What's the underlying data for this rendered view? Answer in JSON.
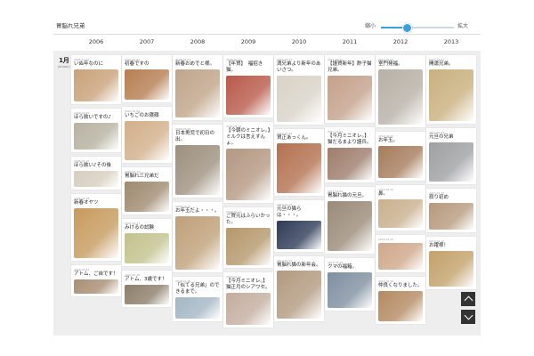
{
  "header": {
    "title": "胃脳れ兄弟",
    "zoom_min": "縮小",
    "zoom_max": "拡大",
    "zoom_level": 0.35
  },
  "years": [
    "2006",
    "2007",
    "2008",
    "2009",
    "2010",
    "2011",
    "2012",
    "2013"
  ],
  "month": {
    "label": "1月",
    "sub": "January"
  },
  "columns": [
    [
      {
        "date": "2006.01.01",
        "title": "いぬ年なのに",
        "h": 36,
        "c": "#c9a27a"
      },
      {
        "date": "2006.01.05",
        "title": "ほら飲いですの♪",
        "h": 30,
        "c": "#b7b2a0"
      },
      {
        "date": "2006.01.10",
        "title": "ほら飲い♪その後",
        "h": 18,
        "c": "#d6cfc0"
      },
      {
        "date": "2006.01.18",
        "title": "新春オヤツ",
        "h": 56,
        "c": "#c79a5e"
      },
      {
        "date": "2006.01.25",
        "title": "アトム、ご自です！",
        "h": 16,
        "c": "#a98e74"
      }
    ],
    [
      {
        "date": "2007.01.01",
        "title": "初春ですの",
        "h": 34,
        "c": "#b67e52"
      },
      {
        "date": "2007.01.04",
        "title": "いちごのお寝顔",
        "h": 44,
        "c": "#d2b08a"
      },
      {
        "date": "2007.01.10",
        "title": "胃脳れ三兄弟だ",
        "h": 34,
        "c": "#9f8a70"
      },
      {
        "date": "2007.01.17",
        "title": "みけるの試験",
        "h": 34,
        "c": "#c2c28e"
      },
      {
        "date": "2007.01.26",
        "title": "アトム、3歳です！",
        "h": 22,
        "c": "#8c7e6a"
      }
    ],
    [
      {
        "date": "2008.01.01",
        "title": "新春おめでと様。",
        "h": 54,
        "c": "#c0a58a"
      },
      {
        "date": "2008.01.06",
        "title": "日本男児で初日の出。",
        "h": 56,
        "c": "#9d907e"
      },
      {
        "date": "2008.01.14",
        "title": "お年玉だよ・・・。",
        "h": 60,
        "c": "#bfa079"
      },
      {
        "date": "2008.01.28",
        "title": "「似てる兄弟」のできるまで。",
        "h": 24,
        "c": "#a4b7c5"
      }
    ],
    [
      {
        "date": "2009.01.01",
        "title": "【年賀】　福招き猫。",
        "h": 44,
        "c": "#b85a4a"
      },
      {
        "date": "2009.01.05",
        "title": "【今朝のミニオレ。】ミルクは言えすんょ。",
        "h": 58,
        "c": "#b49882"
      },
      {
        "date": "2009.01.11",
        "title": "ご賀元はふらいかった。",
        "h": 42,
        "c": "#b5986c"
      },
      {
        "date": "2009.01.20",
        "title": "【今月ミニオレ。】猫正月のシアワセ。",
        "h": 36,
        "c": "#c3aea0"
      }
    ],
    [
      {
        "date": "2010.01.01",
        "title": "満兄弟より新年のあいさつ。",
        "h": 52,
        "c": "#d9d3c8"
      },
      {
        "date": "2010.01.04",
        "title": "賀正あっくん。",
        "h": 56,
        "c": "#b3714f"
      },
      {
        "date": "2010.01.12",
        "title": "元旦の猫らは・・・。",
        "h": 32,
        "c": "#2f3b58"
      },
      {
        "date": "2010.01.22",
        "title": "胃脳れ猫の新年会。",
        "h": 54,
        "c": "#b29a80"
      }
    ],
    [
      {
        "date": "2011.01.01",
        "title": "【謹賀新年】酢子猫兄弟。",
        "h": 50,
        "c": "#c4a18b"
      },
      {
        "date": "2011.01.03",
        "title": "【今月ミニオレ。】猫だるまより謹兵。",
        "h": 36,
        "c": "#9e7d6c"
      },
      {
        "date": "2011.01.08",
        "title": "胃脳れ猫の元旦。",
        "h": 56,
        "c": "#9a8a78"
      },
      {
        "date": "2011.01.19",
        "title": "クマの福箱。",
        "h": 40,
        "c": "#7f8fa0"
      }
    ],
    [
      {
        "date": "2012.01.01",
        "title": "室門発福。",
        "h": 62,
        "c": "#b7b0a6"
      },
      {
        "date": "2012.01.05",
        "title": "お年玉。",
        "h": 36,
        "c": "#a67c5c"
      },
      {
        "date": "2012.01.10",
        "title": "鼻。",
        "h": 32,
        "c": "#c9b08e"
      },
      {
        "date": "2012.01.16",
        "title": "",
        "h": 30,
        "c": "#d0a78a"
      },
      {
        "date": "2012.01.24",
        "title": "仲良くなりました。",
        "h": 34,
        "c": "#b48a62"
      }
    ],
    [
      {
        "date": "2013.01.01",
        "title": "開運兄弟。",
        "h": 58,
        "c": "#c9b07e"
      },
      {
        "date": "2013.01.04",
        "title": "元旦の兄弟",
        "h": 44,
        "c": "#9fa0a2"
      },
      {
        "date": "2013.01.10",
        "title": "寂り初め",
        "h": 30,
        "c": "#b79a7e"
      },
      {
        "date": "2013.01.15",
        "title": "お躍様！",
        "h": 40,
        "c": "#c3a26c"
      }
    ]
  ]
}
